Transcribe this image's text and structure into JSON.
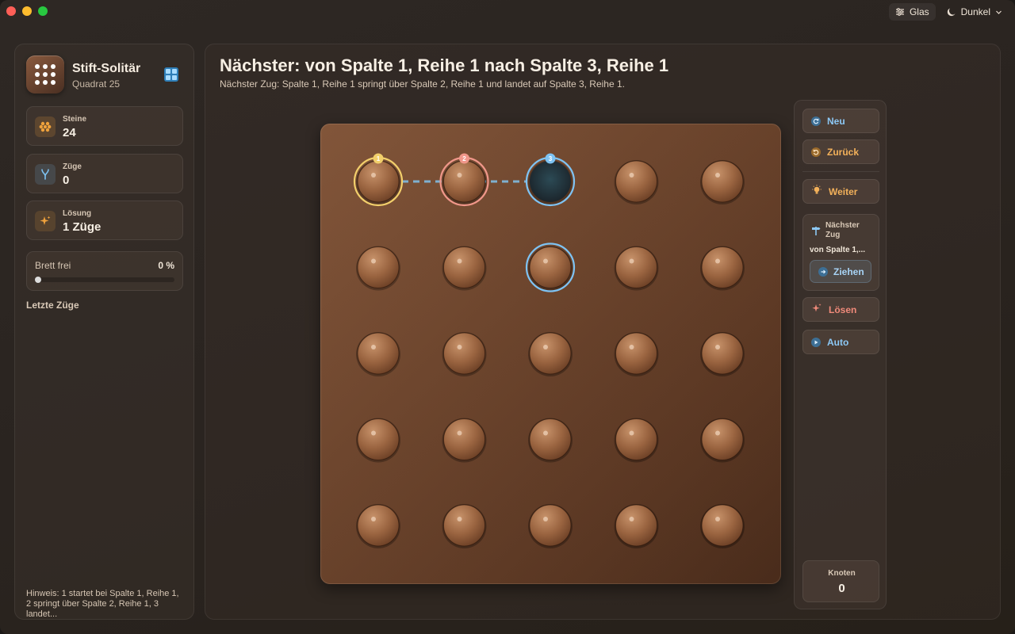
{
  "window": {
    "top_controls": {
      "glass_label": "Glas",
      "theme_label": "Dunkel"
    }
  },
  "sidebar": {
    "app_title": "Stift-Solitär",
    "app_subtitle": "Quadrat 25",
    "stats": [
      {
        "label": "Steine",
        "value": "24",
        "icon": "pegs-icon",
        "color": "#f0a23c"
      },
      {
        "label": "Züge",
        "value": "0",
        "icon": "moves-fork-icon",
        "color": "#7ec3f3"
      },
      {
        "label": "Lösung",
        "value": "1 Züge",
        "icon": "sparkle-icon",
        "color": "#f0a23c"
      }
    ],
    "progress": {
      "label": "Brett frei",
      "percent_label": "0 %",
      "fraction": 0.0
    },
    "recent_moves_title": "Letzte Züge",
    "hint": "Hinweis: 1 startet bei Spalte 1, Reihe 1, 2 springt über Spalte 2, Reihe 1, 3 landet..."
  },
  "main": {
    "title": "Nächster: von Spalte 1, Reihe 1 nach Spalte 3, Reihe 1",
    "subtitle": "Nächster Zug: Spalte 1, Reihe 1 springt über Spalte 2, Reihe 1 und landet auf Spalte 3, Reihe 1."
  },
  "board": {
    "rows": 5,
    "cols": 5,
    "pegs": [
      [
        1,
        1,
        0,
        1,
        1
      ],
      [
        1,
        1,
        1,
        1,
        1
      ],
      [
        1,
        1,
        1,
        1,
        1
      ],
      [
        1,
        1,
        1,
        1,
        1
      ],
      [
        1,
        1,
        1,
        1,
        1
      ]
    ],
    "highlights": [
      {
        "row": 1,
        "col": 1,
        "badge": "1",
        "color": "#f2cf6b"
      },
      {
        "row": 1,
        "col": 2,
        "badge": "2",
        "color": "#f0978a"
      },
      {
        "row": 1,
        "col": 3,
        "badge": "3",
        "color": "#7ec3f3"
      },
      {
        "row": 2,
        "col": 3,
        "badge": "",
        "color": "#7ec3f3"
      }
    ],
    "path_color": "#7fb0cf"
  },
  "controls": {
    "new_label": "Neu",
    "back_label": "Zurück",
    "hint_label": "Weiter",
    "next_move_title": "Nächster Zug",
    "next_move_text": "von Spalte 1,...",
    "pull_label": "Ziehen",
    "solve_label": "Lösen",
    "auto_label": "Auto",
    "nodes_label": "Knoten",
    "nodes_value": "0",
    "colors": {
      "new": "#8cc8f5",
      "back": "#f3b15a",
      "hint": "#f3b15a",
      "solve": "#f08a7a",
      "auto": "#8cc8f5"
    }
  }
}
